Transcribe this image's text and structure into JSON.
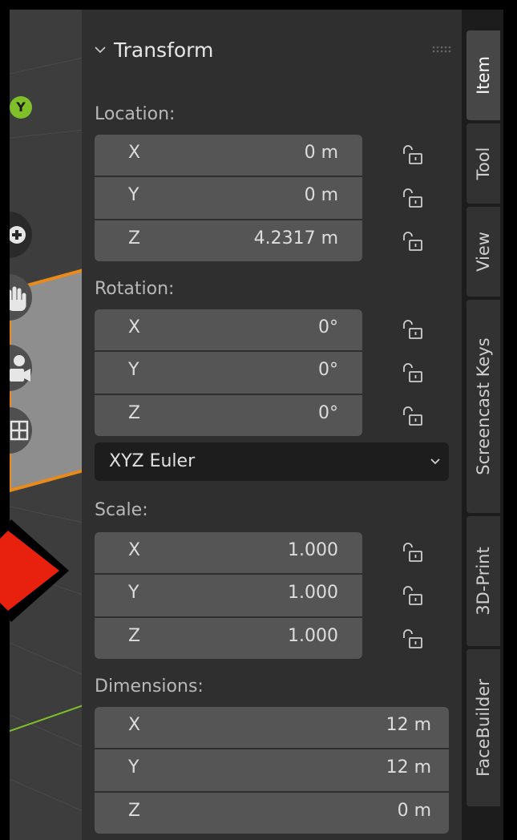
{
  "viewport": {
    "gizmo_axis": "Y",
    "tools": [
      {
        "icon": "zoom-plus-icon"
      },
      {
        "icon": "hand-pan-icon"
      },
      {
        "icon": "camera-icon"
      },
      {
        "icon": "grid-icon"
      }
    ]
  },
  "transform": {
    "title": "Transform",
    "location": {
      "label": "Location:",
      "rows": [
        {
          "axis": "X",
          "value": "0 m"
        },
        {
          "axis": "Y",
          "value": "0 m"
        },
        {
          "axis": "Z",
          "value": "4.2317 m"
        }
      ]
    },
    "rotation": {
      "label": "Rotation:",
      "rows": [
        {
          "axis": "X",
          "value": "0°"
        },
        {
          "axis": "Y",
          "value": "0°"
        },
        {
          "axis": "Z",
          "value": "0°"
        }
      ],
      "mode": "XYZ Euler"
    },
    "scale": {
      "label": "Scale:",
      "rows": [
        {
          "axis": "X",
          "value": "1.000"
        },
        {
          "axis": "Y",
          "value": "1.000"
        },
        {
          "axis": "Z",
          "value": "1.000"
        }
      ]
    },
    "dimensions": {
      "label": "Dimensions:",
      "rows": [
        {
          "axis": "X",
          "value": "12 m"
        },
        {
          "axis": "Y",
          "value": "12 m"
        },
        {
          "axis": "Z",
          "value": "0 m"
        }
      ]
    }
  },
  "tabs": [
    {
      "label": "Item",
      "active": true
    },
    {
      "label": "Tool",
      "active": false
    },
    {
      "label": "View",
      "active": false
    },
    {
      "label": "Screencast Keys",
      "active": false
    },
    {
      "label": "3D-Print",
      "active": false
    },
    {
      "label": "FaceBuilder",
      "active": false
    }
  ],
  "colors": {
    "panel_bg": "#2f2f2f",
    "field_bg": "#555555",
    "accent_orange": "#e88a1c",
    "arrow_red": "#e8200e",
    "gizmo_green": "#7fbf2a"
  }
}
